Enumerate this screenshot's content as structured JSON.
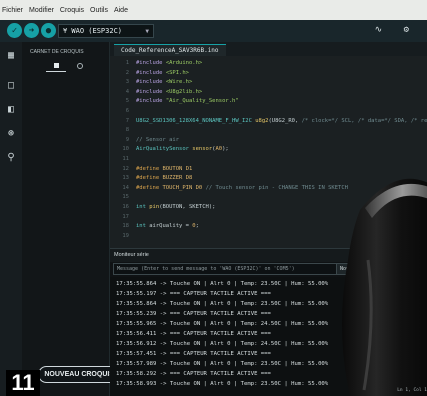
{
  "menu": [
    "Fichier",
    "Modifier",
    "Croquis",
    "Outils",
    "Aide"
  ],
  "toolbar": {
    "verify_icon": "check-icon",
    "upload_icon": "arrow-right-icon",
    "debug_icon": "debug-icon",
    "board_label": "¥ WAO (ESP32C)",
    "right_icons": "∿ ⚙"
  },
  "sketchbook": {
    "title": "CARNET DE CROQUIS",
    "new_sketch_label": "NOUVEAU CROQUIS"
  },
  "editor": {
    "file_tab": "Code_ReferenceA_SAV3R6B.ino",
    "lines": [
      {
        "n": "1",
        "html": "<span class='kw-incl'>#include</span> <span class='str'>&lt;Arduino.h&gt;</span>"
      },
      {
        "n": "2",
        "html": "<span class='kw-incl'>#include</span> <span class='str'>&lt;SPI.h&gt;</span>"
      },
      {
        "n": "3",
        "html": "<span class='kw-incl'>#include</span> <span class='str'>&lt;Wire.h&gt;</span>"
      },
      {
        "n": "4",
        "html": "<span class='kw-incl'>#include</span> <span class='str'>&lt;U8g2lib.h&gt;</span>"
      },
      {
        "n": "5",
        "html": "<span class='kw-incl'>#include</span> <span class='str'>\"Air_Quality_Sensor.h\"</span>"
      },
      {
        "n": "6",
        "html": ""
      },
      {
        "n": "7",
        "html": "<span class='kw-type'>U8G2_SSD1306_128X64_NONAME_F_HW_I2C</span> <span class='fn'>u8g2</span>(U8G2_R0, <span class='cmt'>/* clock=*/ SCL, /* data=*/ SDA, /* reset=*/ U8X8_PIN_NONE);</span>"
      },
      {
        "n": "8",
        "html": ""
      },
      {
        "n": "9",
        "html": "<span class='cmt'>// Sensor air</span>"
      },
      {
        "n": "10",
        "html": "<span class='kw-type'>AirQualitySensor</span> <span class='fn'>sensor</span>(<span class='num'>A0</span>);"
      },
      {
        "n": "11",
        "html": ""
      },
      {
        "n": "12",
        "html": "<span class='kw-def'>#define</span> <span class='num'>BOUTON</span> <span class='num'>D1</span>"
      },
      {
        "n": "13",
        "html": "<span class='kw-def'>#define</span> <span class='num'>BUZZER</span> <span class='num'>D8</span>"
      },
      {
        "n": "14",
        "html": "<span class='kw-def'>#define</span> <span class='num'>TOUCH_PIN</span> <span class='num'>D0</span> <span class='cmt'>// Touch sensor pin - CHANGE THIS IN SKETCH</span>"
      },
      {
        "n": "15",
        "html": ""
      },
      {
        "n": "16",
        "html": "<span class='kw-type'>int</span> <span class='fn'>pin</span>(BOUTON, SKETCH);"
      },
      {
        "n": "17",
        "html": ""
      },
      {
        "n": "18",
        "html": "<span class='kw-type'>int</span> airQuality = <span class='num'>0</span>;"
      },
      {
        "n": "19",
        "html": ""
      }
    ]
  },
  "serial": {
    "title": "Moniteur série",
    "message_placeholder": "Message (Enter to send message to 'WAO (ESP32C)' on 'COM5')",
    "line_ending": "Nouvelle ligne",
    "lines": [
      "17:35:55.864 -> Touche ON | Alrt 0 | Temp: 23.50C | Hum: 55.00%",
      "17:35:55.197 -> === CAPTEUR TACTILE ACTIVE ===",
      "17:35:55.864 -> Touche ON | Alrt 0 | Temp: 23.50C | Hum: 55.00%",
      "17:35:55.239 -> === CAPTEUR TACTILE ACTIVE ===",
      "17:35:55.965 -> Touche ON | Alrt 0 | Temp: 24.50C | Hum: 55.00%",
      "17:35:56.411 -> === CAPTEUR TACTILE ACTIVE ===",
      "17:35:56.912 -> Touche ON | Alrt 0 | Temp: 24.50C | Hum: 55.00%",
      "17:35:57.451 -> === CAPTEUR TACTILE ACTIVE ===",
      "17:35:57.989 -> Touche ON | Alrt 0 | Temp: 23.50C | Hum: 55.00%",
      "17:35:58.292 -> === CAPTEUR TACTILE ACTIVE ===",
      "17:35:58.993 -> Touche ON | Alrt 0 | Temp: 23.50C | Hum: 55.00%"
    ]
  },
  "badge": "11",
  "status": "Ln 1, Col 1"
}
